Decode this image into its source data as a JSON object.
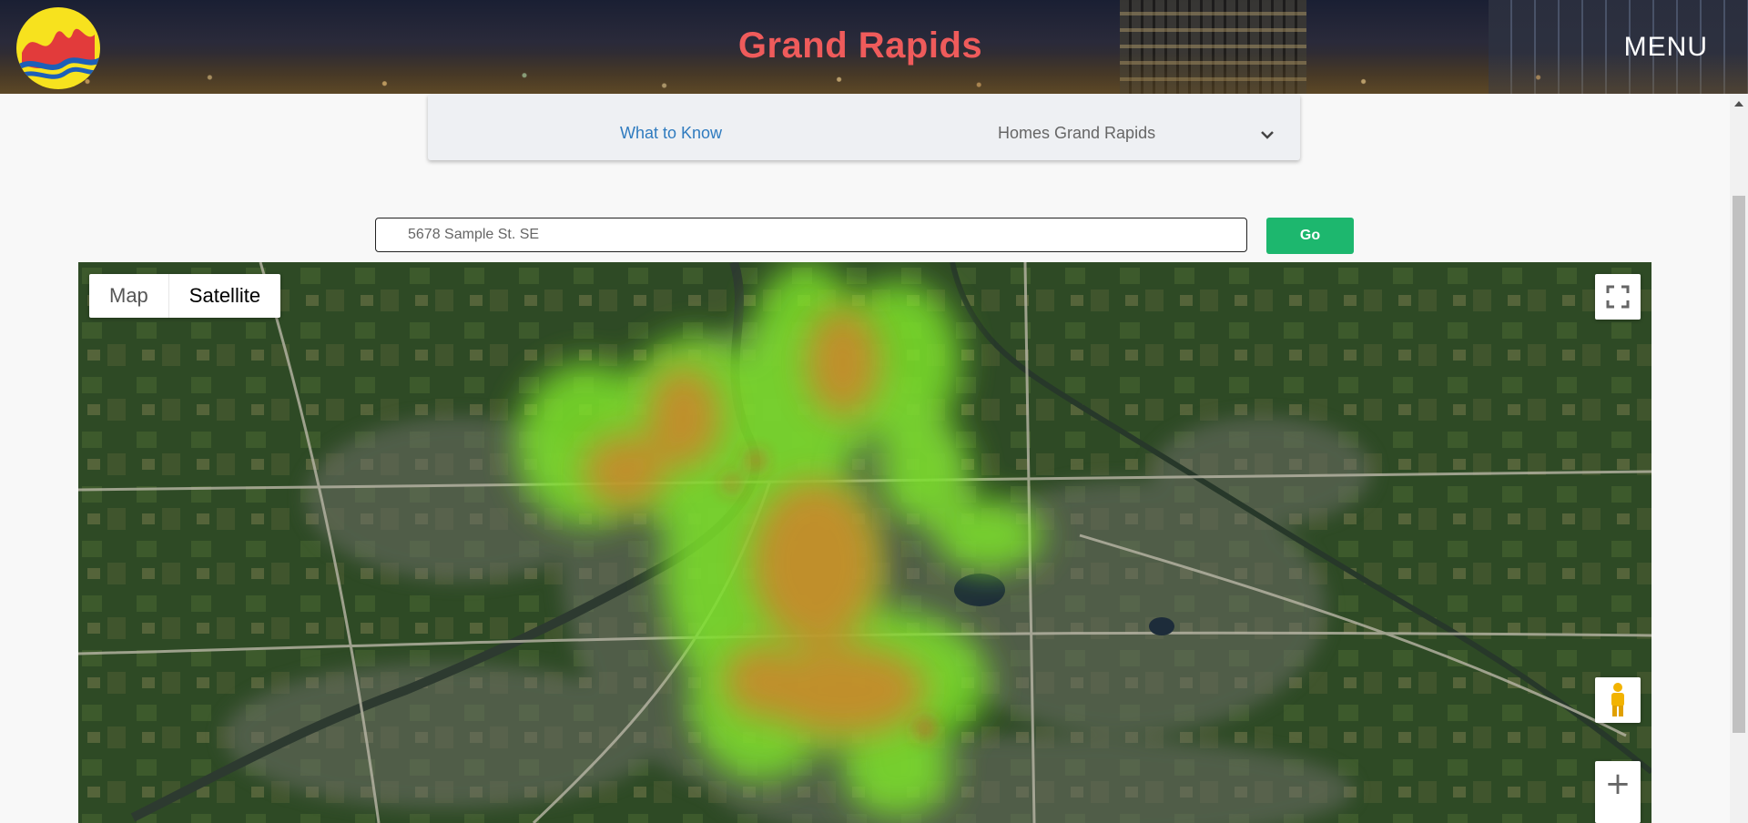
{
  "header": {
    "title": "Grand Rapids",
    "menu_label": "MENU",
    "logo_icon": "grand-rapids-logo-icon",
    "title_color": "#ef5b5b"
  },
  "subnav": {
    "items": [
      {
        "label": "What to Know",
        "active": true
      },
      {
        "label": "Homes Grand Rapids",
        "active": false
      }
    ],
    "dropdown_icon": "chevron-down-icon"
  },
  "search": {
    "placeholder": "5678 Sample St. SE",
    "value": "",
    "button_label": "Go",
    "button_color": "#1db76e"
  },
  "map": {
    "type_options": [
      "Map",
      "Satellite"
    ],
    "selected_type": "Satellite",
    "overlay": "heatmap",
    "controls": [
      "fullscreen-icon",
      "pegman-icon",
      "zoom-in-icon"
    ]
  }
}
